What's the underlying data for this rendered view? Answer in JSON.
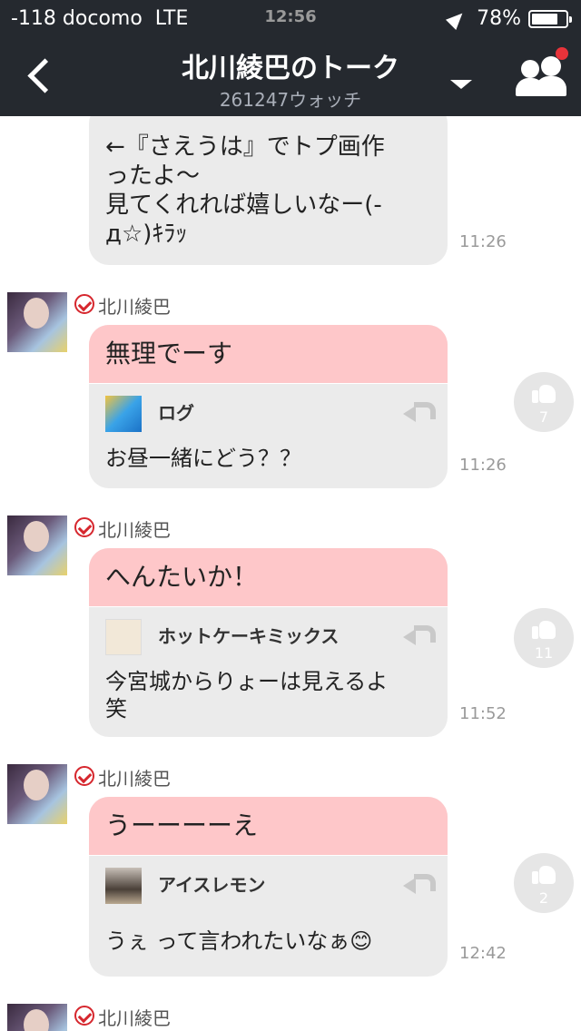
{
  "status_bar": {
    "carrier": "-118 docomo",
    "network": "LTE",
    "time": "12:56",
    "battery": "78%",
    "battery_level": 0.78
  },
  "header": {
    "title": "北川綾巴のトーク",
    "watch_count": "261247ウォッチ"
  },
  "messages": [
    {
      "body": "←『さえうは』でトプ画作ったよ〜\n見てくれれば嬉しいなー(-д☆)ｷﾗｯ",
      "time": "11:26"
    },
    {
      "sender": "北川綾巴",
      "reply": "無理でーす",
      "ref_name": "ログ",
      "body": "お昼一緒にどう？？",
      "time": "11:26",
      "likes": "7"
    },
    {
      "sender": "北川綾巴",
      "reply": "へんたいか！",
      "ref_name": "ホットケーキミックス",
      "body": "今宮城からりょーは見えるよ笑",
      "time": "11:52",
      "likes": "11"
    },
    {
      "sender": "北川綾巴",
      "reply": "うーーーーえ",
      "ref_name": "アイスレモン",
      "body": "うぇ って言われたいなぁ😊",
      "time": "12:42",
      "likes": "2"
    },
    {
      "sender": "北川綾巴"
    }
  ],
  "colors": {
    "header_bg": "#25292f",
    "reply_bg": "#fec7c9",
    "bubble_bg": "#ebebeb",
    "verified": "#d6272e",
    "notification": "#e8333a"
  },
  "icons": [
    "back-icon",
    "dropdown-icon",
    "friends-icon",
    "location-arrow-icon",
    "battery-icon",
    "verified-check-icon",
    "reply-icon",
    "like-thumb-icon"
  ]
}
